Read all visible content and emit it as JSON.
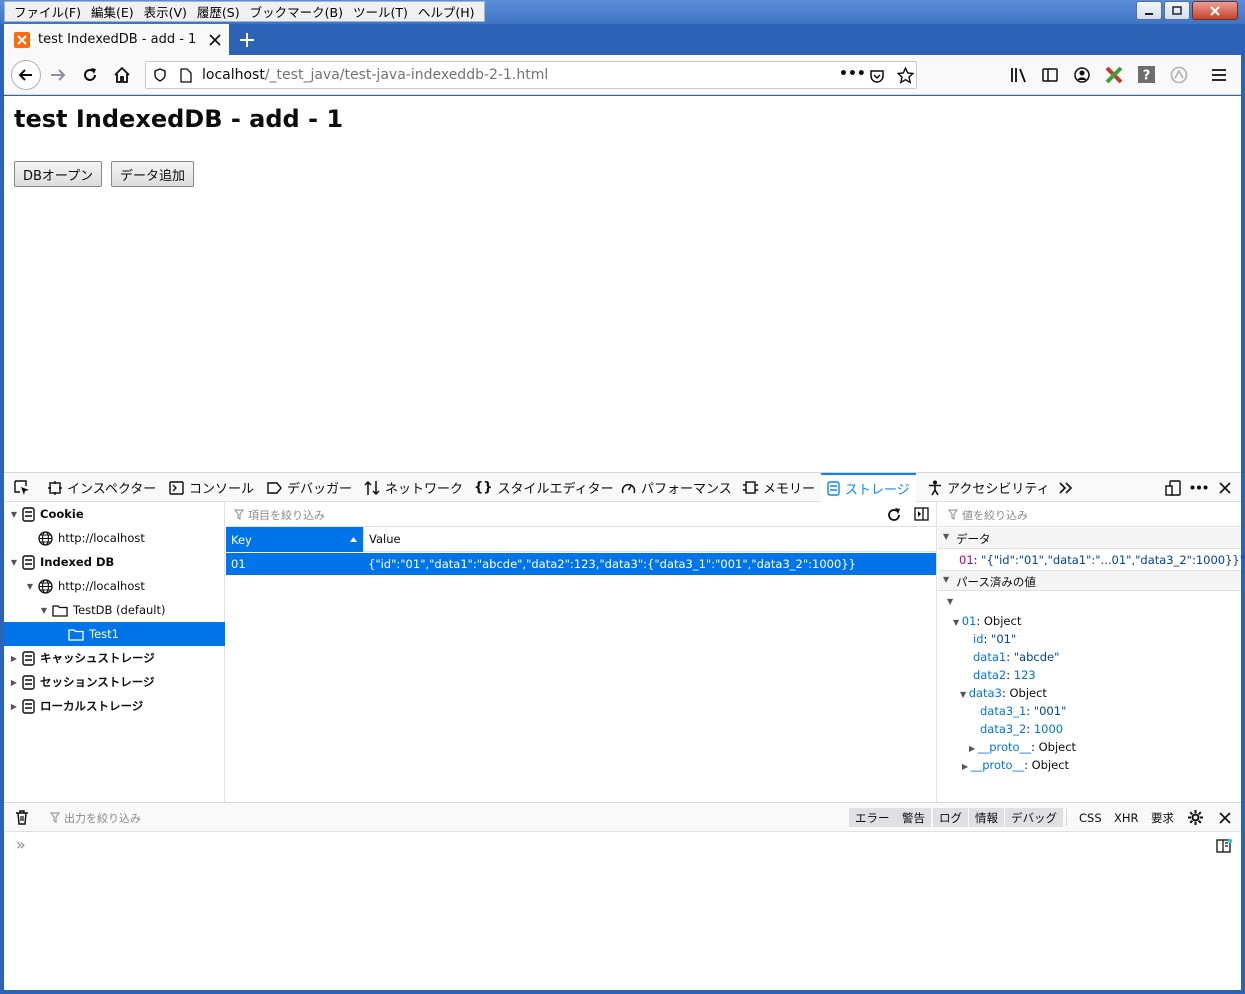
{
  "window": {
    "menu": [
      "ファイル(F)",
      "編集(E)",
      "表示(V)",
      "履歴(S)",
      "ブックマーク(B)",
      "ツール(T)",
      "ヘルプ(H)"
    ]
  },
  "tab": {
    "title": "test IndexedDB - add - 1"
  },
  "navbar": {
    "url_host": "localhost",
    "url_path": "/_test_java/test-java-indexeddb-2-1.html",
    "more_label": "•••"
  },
  "page": {
    "heading": "test IndexedDB - add - 1",
    "buttons": [
      "DBオープン",
      "データ追加"
    ]
  },
  "devtools": {
    "tabs": [
      {
        "label": "インスペクター",
        "icon": "inspector-icon"
      },
      {
        "label": "コンソール",
        "icon": "console-icon"
      },
      {
        "label": "デバッガー",
        "icon": "debugger-icon"
      },
      {
        "label": "ネットワーク",
        "icon": "network-icon"
      },
      {
        "label": "スタイルエディター",
        "icon": "style-editor-icon"
      },
      {
        "label": "パフォーマンス",
        "icon": "performance-icon"
      },
      {
        "label": "メモリー",
        "icon": "memory-icon"
      },
      {
        "label": "ストレージ",
        "icon": "storage-icon"
      },
      {
        "label": "アクセシビリティ",
        "icon": "accessibility-icon"
      }
    ],
    "tree": [
      {
        "label": "Cookie",
        "depth": 0,
        "kind": "store",
        "twisty": "open",
        "bold": true
      },
      {
        "label": "http://localhost",
        "depth": 1,
        "kind": "globe"
      },
      {
        "label": "Indexed DB",
        "depth": 0,
        "kind": "store",
        "twisty": "open",
        "bold": true
      },
      {
        "label": "http://localhost",
        "depth": 1,
        "kind": "globe",
        "twisty": "open"
      },
      {
        "label": "TestDB (default)",
        "depth": 2,
        "kind": "folder",
        "twisty": "open"
      },
      {
        "label": "Test1",
        "depth": 3,
        "kind": "folder",
        "selected": true
      },
      {
        "label": "キャッシュストレージ",
        "depth": 0,
        "kind": "store",
        "twisty": "closed",
        "bold": true
      },
      {
        "label": "セッションストレージ",
        "depth": 0,
        "kind": "store",
        "twisty": "closed",
        "bold": true
      },
      {
        "label": "ローカルストレージ",
        "depth": 0,
        "kind": "store",
        "twisty": "closed",
        "bold": true
      }
    ],
    "table": {
      "filter_placeholder": "項目を絞り込み",
      "columns": [
        "Key",
        "Value"
      ],
      "rows": [
        {
          "key": "01",
          "value": "{\"id\":\"01\",\"data1\":\"abcde\",\"data2\":123,\"data3\":{\"data3_1\":\"001\",\"data3_2\":1000}}"
        }
      ]
    },
    "sidebar": {
      "filter_placeholder": "値を絞り込み",
      "data_section": "データ",
      "data_key": "01",
      "data_value": "\"{\"id\":\"01\",\"data1\":\"...01\",\"data3_2\":1000}}\"",
      "parsed_section": "パース済みの値",
      "obj_key": "01",
      "obj_type": "Object",
      "id_key": "id",
      "id_value": "\"01\"",
      "data1_key": "data1",
      "data1_value": "\"abcde\"",
      "data2_key": "data2",
      "data2_value": "123",
      "data3_key": "data3",
      "data3_type": "Object",
      "data3_1_key": "data3_1",
      "data3_1_value": "\"001\"",
      "data3_2_key": "data3_2",
      "data3_2_value": "1000",
      "proto_key": "__proto__",
      "proto_type": "Object"
    },
    "console": {
      "filter_placeholder": "出力を絞り込み",
      "levels": [
        "エラー",
        "警告",
        "ログ",
        "情報",
        "デバッグ"
      ],
      "types": [
        "CSS",
        "XHR",
        "要求"
      ],
      "prompt": "»"
    }
  }
}
